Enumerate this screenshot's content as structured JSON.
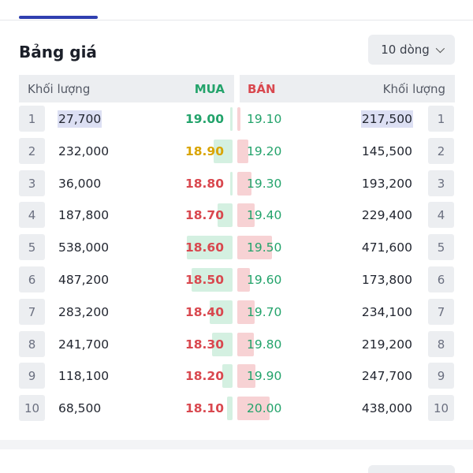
{
  "orderbook": {
    "title": "Bảng giá",
    "rows_selector": "10 dòng",
    "header": {
      "bid_volume": "Khối lượng",
      "bid_side": "MUA",
      "ask_side": "BÁN",
      "ask_volume": "Khối lượng"
    },
    "colors": {
      "up": "#23a36b",
      "down": "#d9484f",
      "reference": "#d9a400",
      "bid_bar": "#d4f0e1",
      "ask_bar": "#f7d2d4",
      "highlight": "#dcdff3"
    },
    "rows": [
      {
        "index": "1",
        "bid_volume": "27,700",
        "bid_price": "19.00",
        "bid_color": "#23a36b",
        "bid_bar_pct": 2,
        "ask_price": "19.10",
        "ask_color": "#23a36b",
        "ask_bar_pct": 8,
        "ask_volume": "217,500",
        "highlight": true
      },
      {
        "index": "2",
        "bid_volume": "232,000",
        "bid_price": "18.90",
        "bid_color": "#d9a400",
        "bid_bar_pct": 41,
        "ask_price": "19.20",
        "ask_color": "#23a36b",
        "ask_bar_pct": 31,
        "ask_volume": "145,500",
        "highlight": false
      },
      {
        "index": "3",
        "bid_volume": "36,000",
        "bid_price": "18.80",
        "bid_color": "#d9484f",
        "bid_bar_pct": 6,
        "ask_price": "19.30",
        "ask_color": "#23a36b",
        "ask_bar_pct": 41,
        "ask_volume": "193,200",
        "highlight": false
      },
      {
        "index": "4",
        "bid_volume": "187,800",
        "bid_price": "18.70",
        "bid_color": "#d9484f",
        "bid_bar_pct": 33,
        "ask_price": "19.40",
        "ask_color": "#23a36b",
        "ask_bar_pct": 49,
        "ask_volume": "229,400",
        "highlight": false
      },
      {
        "index": "5",
        "bid_volume": "538,000",
        "bid_price": "18.60",
        "bid_color": "#d9484f",
        "bid_bar_pct": 100,
        "ask_price": "19.50",
        "ask_color": "#23a36b",
        "ask_bar_pct": 100,
        "ask_volume": "471,600",
        "highlight": false
      },
      {
        "index": "6",
        "bid_volume": "487,200",
        "bid_price": "18.50",
        "bid_color": "#d9484f",
        "bid_bar_pct": 90,
        "ask_price": "19.60",
        "ask_color": "#23a36b",
        "ask_bar_pct": 37,
        "ask_volume": "173,800",
        "highlight": false
      },
      {
        "index": "7",
        "bid_volume": "283,200",
        "bid_price": "18.40",
        "bid_color": "#d9484f",
        "bid_bar_pct": 50,
        "ask_price": "19.70",
        "ask_color": "#23a36b",
        "ask_bar_pct": 50,
        "ask_volume": "234,100",
        "highlight": false
      },
      {
        "index": "8",
        "bid_volume": "241,700",
        "bid_price": "18.30",
        "bid_color": "#d9484f",
        "bid_bar_pct": 45,
        "ask_price": "19.80",
        "ask_color": "#23a36b",
        "ask_bar_pct": 47,
        "ask_volume": "219,200",
        "highlight": false
      },
      {
        "index": "9",
        "bid_volume": "118,100",
        "bid_price": "18.20",
        "bid_color": "#d9484f",
        "bid_bar_pct": 22,
        "ask_price": "19.90",
        "ask_color": "#23a36b",
        "ask_bar_pct": 53,
        "ask_volume": "247,700",
        "highlight": false
      },
      {
        "index": "10",
        "bid_volume": "68,500",
        "bid_price": "18.10",
        "bid_color": "#d9484f",
        "bid_bar_pct": 12,
        "ask_price": "20.00",
        "ask_color": "#23a36b",
        "ask_bar_pct": 93,
        "ask_volume": "438,000",
        "highlight": false
      }
    ]
  }
}
